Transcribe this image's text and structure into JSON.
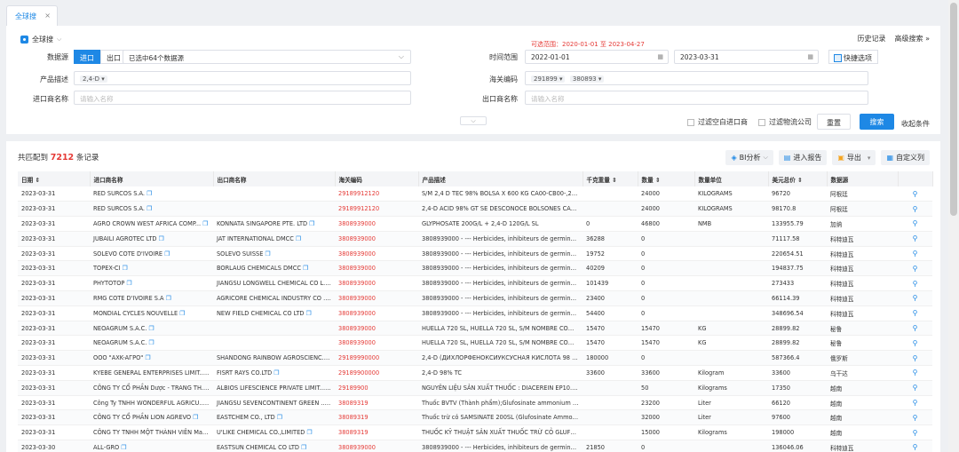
{
  "tab": {
    "label": "全球搜",
    "close": "×"
  },
  "panel": {
    "title": "全球搜",
    "history": "历史记录",
    "advanced": "高级搜索",
    "advanced_arrow": "»",
    "source_label": "数据源",
    "import_btn": "进口",
    "export_btn": "出口",
    "datasets_value": "已选中64个数据源",
    "range_hint": "可选范围：2020-01-01 至 2023-04-27",
    "time_label": "时间范围",
    "date_from": "2022-01-01",
    "date_to": "2023-03-31",
    "quick_btn": "快捷选项",
    "product_label": "产品描述",
    "product_chip": "2,4-D",
    "hs_label": "海关编码",
    "hs_chips": [
      "291899",
      "380893"
    ],
    "importer_label": "进口商名称",
    "importer_placeholder": "请输入名称",
    "exporter_label": "出口商名称",
    "exporter_placeholder": "请输入名称",
    "filter_importer": "过滤空白进口商",
    "filter_logistics": "过滤物流公司",
    "reset_btn": "重置",
    "search_btn": "搜索",
    "collapse": "收起条件"
  },
  "results": {
    "prefix": "共匹配到",
    "count": "7212",
    "suffix": "条记录",
    "tools": {
      "bi": "BI分析",
      "report": "进入报告",
      "export": "导出",
      "custom": "自定义列"
    },
    "columns": [
      "日期",
      "进口商名称",
      "出口商名称",
      "海关编码",
      "产品描述",
      "千克重量",
      "数量",
      "数量单位",
      "美元总价",
      "数据源"
    ],
    "rows": [
      {
        "date": "2023-03-31",
        "importer": "RED SURCOS S.A.",
        "exporter": "",
        "hs": "29189912120",
        "desc": "S/M 2,4 D TEC 98% BOLSA X 600 KG CA00-CB00-,2,4 D...",
        "kg": "",
        "qty": "24000",
        "unit": "KILOGRAMS",
        "usd": "96720",
        "src": "阿根廷"
      },
      {
        "date": "2023-03-31",
        "importer": "RED SURCOS S.A.",
        "exporter": "",
        "hs": "29189912120",
        "desc": "2,4-D ACID 98% GT SE DESCONOCE BOLSONES CA00-...",
        "kg": "",
        "qty": "24000",
        "unit": "KILOGRAMS",
        "usd": "98170.8",
        "src": "阿根廷"
      },
      {
        "date": "2023-03-31",
        "importer": "AGRO CROWN WEST AFRICA COMP...",
        "exporter": "KONNATA SINGAPORE PTE. LTD",
        "hs": "3808939000",
        "desc": "GLYPHOSATE 200G/L + 2,4-D 120G/L SL",
        "kg": "0",
        "qty": "46800",
        "unit": "NMB",
        "usd": "133955.79",
        "src": "加纳"
      },
      {
        "date": "2023-03-31",
        "importer": "JUBAILI AGROTEC LTD",
        "exporter": "JAT INTERNATIONAL DMCC",
        "hs": "3808939000",
        "desc": "3808939000 - --- Herbicides, inhibiteurs de germination ...",
        "kg": "36288",
        "qty": "0",
        "unit": "",
        "usd": "71117.58",
        "src": "科特迪瓦"
      },
      {
        "date": "2023-03-31",
        "importer": "SOLEVO COTE D'IVOIRE",
        "exporter": "SOLEVO SUISSE",
        "hs": "3808939000",
        "desc": "3808939000 - --- Herbicides, inhibiteurs de germination ...",
        "kg": "19752",
        "qty": "0",
        "unit": "",
        "usd": "220654.51",
        "src": "科特迪瓦"
      },
      {
        "date": "2023-03-31",
        "importer": "TOPEX-CI",
        "exporter": "BORLAUG CHEMICALS DMCC",
        "hs": "3808939000",
        "desc": "3808939000 - --- Herbicides, inhibiteurs de germination ...",
        "kg": "40209",
        "qty": "0",
        "unit": "",
        "usd": "194837.75",
        "src": "科特迪瓦"
      },
      {
        "date": "2023-03-31",
        "importer": "PHYTOTOP",
        "exporter": "JIANGSU LONGWELL CHEMICAL CO L...",
        "hs": "3808939000",
        "desc": "3808939000 - --- Herbicides, inhibiteurs de germination ...",
        "kg": "101439",
        "qty": "0",
        "unit": "",
        "usd": "273433",
        "src": "科特迪瓦"
      },
      {
        "date": "2023-03-31",
        "importer": "RMG COTE D'IVOIRE S.A",
        "exporter": "AGRICORE CHEMICAL INDUSTRY CO ...",
        "hs": "3808939000",
        "desc": "3808939000 - --- Herbicides, inhibiteurs de germination ...",
        "kg": "23400",
        "qty": "0",
        "unit": "",
        "usd": "66114.39",
        "src": "科特迪瓦"
      },
      {
        "date": "2023-03-31",
        "importer": "MONDIAL CYCLES NOUVELLE",
        "exporter": "NEW FIELD CHEMICAL CO LTD",
        "hs": "3808939000",
        "desc": "3808939000 - --- Herbicides, inhibiteurs de germination ...",
        "kg": "54400",
        "qty": "0",
        "unit": "",
        "usd": "348696.54",
        "src": "科特迪瓦"
      },
      {
        "date": "2023-03-31",
        "importer": "NEOAGRUM S.A.C.",
        "exporter": "",
        "hs": "3808939000",
        "desc": "HUELLA 720 SL, HUELLA 720 SL, S/M NOMBRE COMERC...",
        "kg": "15470",
        "qty": "15470",
        "unit": "KG",
        "usd": "28899.82",
        "src": "秘鲁"
      },
      {
        "date": "2023-03-31",
        "importer": "NEOAGRUM S.A.C.",
        "exporter": "",
        "hs": "3808939000",
        "desc": "HUELLA 720 SL, HUELLA 720 SL, S/M NOMBRE COMERC...",
        "kg": "15470",
        "qty": "15470",
        "unit": "KG",
        "usd": "28899.82",
        "src": "秘鲁"
      },
      {
        "date": "2023-03-31",
        "importer": "OOO \"AXK-AГРО\"",
        "exporter": "SHANDONG RAINBOW AGROSCIENC...",
        "hs": "29189990000",
        "desc": "2,4-D (ДИХЛОРФЕНОКСИУКСУСНАЯ КИСЛОТА 98 %) ...",
        "kg": "180000",
        "qty": "0",
        "unit": "",
        "usd": "587366.4",
        "src": "俄罗斯"
      },
      {
        "date": "2023-03-31",
        "importer": "KYEBE GENERAL ENTERPRISES LIMIT...",
        "exporter": "FISRT RAYS CO.LTD",
        "hs": "29189900000",
        "desc": "2,4-D 98% TC",
        "kg": "33600",
        "qty": "33600",
        "unit": "Kilogram",
        "usd": "33600",
        "src": "乌干达"
      },
      {
        "date": "2023-03-31",
        "importer": "CÔNG TY CỔ PHẦN Dược - TRANG TH...",
        "exporter": "ALBIOS LIFESCIENCE PRIVATE LIMIT...",
        "hs": "29189900",
        "desc": "NGUYÊN LIỆU SẢN XUẤT THUỐC : DIACEREIN EP10. BA...",
        "kg": "",
        "qty": "50",
        "unit": "Kilograms",
        "usd": "17350",
        "src": "越南"
      },
      {
        "date": "2023-03-31",
        "importer": "Công Ty TNHH WONDERFUL AGRICU...",
        "exporter": "JIANGSU SEVENCONTINENT GREEN ...",
        "hs": "38089319",
        "desc": "Thuốc BVTV (Thành phẩm);Glufosinate ammonium 200 g...",
        "kg": "",
        "qty": "23200",
        "unit": "Liter",
        "usd": "66120",
        "src": "越南"
      },
      {
        "date": "2023-03-31",
        "importer": "CÔNG TY CỔ PHẦN LION AGREVO",
        "exporter": "EASTCHEM CO., LTD",
        "hs": "38089319",
        "desc": "Thuốc trừ cỏ SAMSINATE 200SL (Glufosinate Ammonium ...",
        "kg": "",
        "qty": "32000",
        "unit": "Liter",
        "usd": "97600",
        "src": "越南"
      },
      {
        "date": "2023-03-31",
        "importer": "CÔNG TY TNHH MỘT THÀNH VIÊN Ma...",
        "exporter": "U'LIKE CHEMICAL CO.,LIMITED",
        "hs": "38089319",
        "desc": "THUỐC KỸ THUẬT SẢN XUẤT THUỐC TRỪ CỎ GLUFOSI...",
        "kg": "",
        "qty": "15000",
        "unit": "Kilograms",
        "usd": "198000",
        "src": "越南"
      },
      {
        "date": "2023-03-30",
        "importer": "ALL-GRO",
        "exporter": "EASTSUN CHEMICAL CO LTD",
        "hs": "3808939000",
        "desc": "3808939000 - --- Herbicides, inhibiteurs de germination ...",
        "kg": "21850",
        "qty": "0",
        "unit": "",
        "usd": "136046.06",
        "src": "科特迪瓦"
      }
    ]
  },
  "colors": {
    "accent": "#1e88e5",
    "hs_code": "#e53935",
    "count": "#e53935"
  }
}
